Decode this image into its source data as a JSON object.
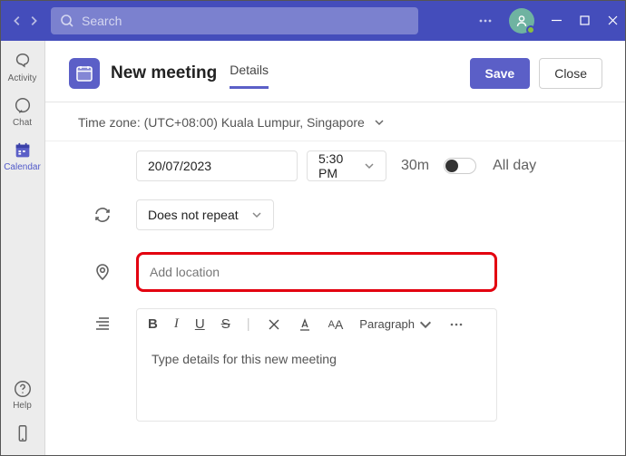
{
  "titlebar": {
    "search_placeholder": "Search"
  },
  "rail": {
    "activity": "Activity",
    "chat": "Chat",
    "calendar": "Calendar",
    "help": "Help"
  },
  "header": {
    "title": "New meeting",
    "tab_details": "Details",
    "save": "Save",
    "close": "Close"
  },
  "timezone": {
    "label": "Time zone: (UTC+08:00) Kuala Lumpur, Singapore"
  },
  "datetime": {
    "date": "20/07/2023",
    "time": "5:30 PM",
    "duration": "30m",
    "all_day": "All day"
  },
  "recurrence": {
    "value": "Does not repeat"
  },
  "location": {
    "placeholder": "Add location"
  },
  "editor": {
    "paragraph": "Paragraph",
    "placeholder": "Type details for this new meeting"
  }
}
